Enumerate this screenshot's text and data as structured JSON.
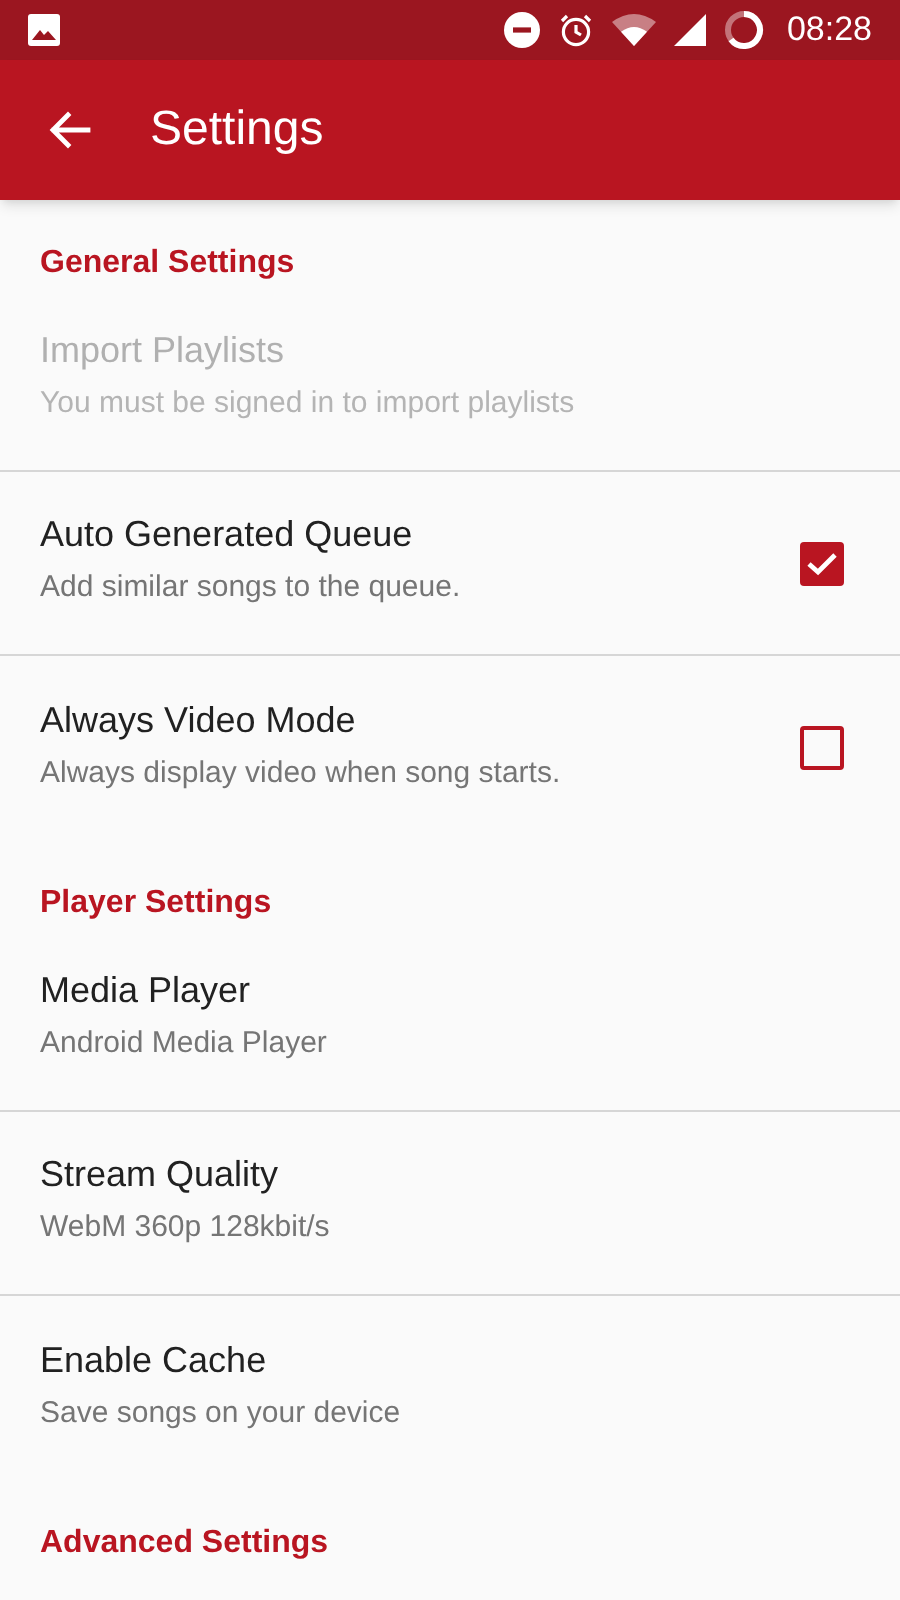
{
  "status_bar": {
    "time": "08:28"
  },
  "app_bar": {
    "title": "Settings"
  },
  "sections": [
    {
      "title": "General Settings",
      "items": [
        {
          "kind": "plain",
          "title": "Import Playlists",
          "summary": "You must be signed in to import playlists",
          "disabled": true
        },
        {
          "kind": "checkbox",
          "title": "Auto Generated Queue",
          "summary": "Add similar songs to the queue.",
          "disabled": false,
          "checked": true
        },
        {
          "kind": "checkbox",
          "title": "Always Video Mode",
          "summary": "Always display video when song starts.",
          "disabled": false,
          "checked": false
        }
      ]
    },
    {
      "title": "Player Settings",
      "items": [
        {
          "kind": "plain",
          "title": "Media Player",
          "summary": "Android Media Player",
          "disabled": false
        },
        {
          "kind": "plain",
          "title": "Stream Quality",
          "summary": "WebM 360p 128kbit/s",
          "disabled": false
        },
        {
          "kind": "plain",
          "title": "Enable Cache",
          "summary": "Save songs on your device",
          "disabled": false
        }
      ]
    },
    {
      "title": "Advanced Settings"
    }
  ]
}
